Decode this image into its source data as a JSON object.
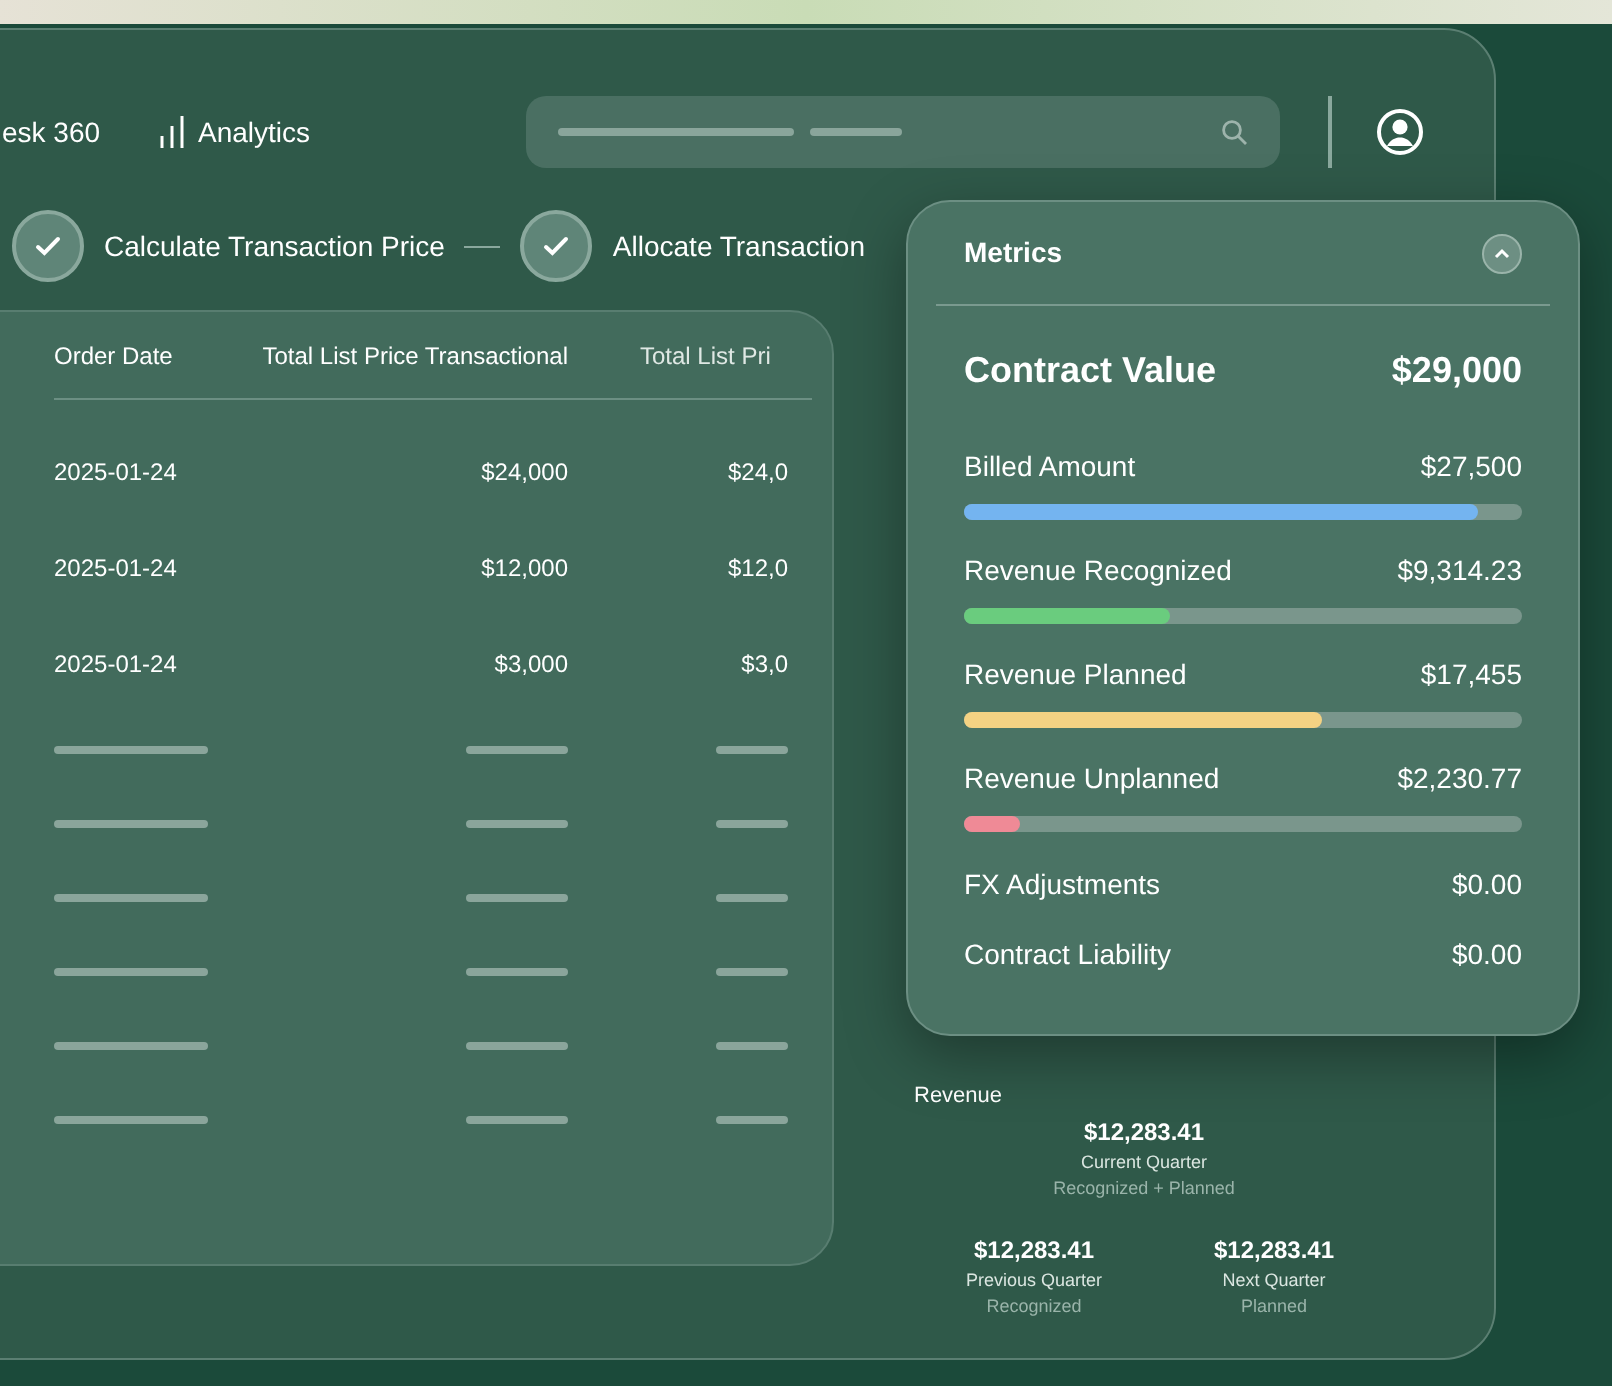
{
  "header": {
    "brand": "esk 360",
    "analytics": "Analytics"
  },
  "steps": [
    {
      "label": "Calculate Transaction Price",
      "checked": true
    },
    {
      "label": "Allocate Transaction",
      "checked": true
    }
  ],
  "table": {
    "columns": [
      "Order Date",
      "Total List Price Transactional",
      "Total List Pri"
    ],
    "rows": [
      {
        "kind": "data",
        "cells": [
          "2025-01-24",
          "$24,000",
          "$24,0"
        ]
      },
      {
        "kind": "data",
        "cells": [
          "2025-01-24",
          "$12,000",
          "$12,0"
        ]
      },
      {
        "kind": "data",
        "cells": [
          "2025-01-24",
          "$3,000",
          "$3,0"
        ]
      },
      {
        "kind": "placeholder"
      },
      {
        "kind": "placeholder"
      },
      {
        "kind": "placeholder"
      },
      {
        "kind": "placeholder"
      },
      {
        "kind": "placeholder"
      },
      {
        "kind": "placeholder"
      }
    ]
  },
  "metrics": {
    "title": "Metrics",
    "expanded": true,
    "items": [
      {
        "kind": "headline",
        "name": "Contract Value",
        "value": "$29,000"
      },
      {
        "kind": "bar",
        "name": "Billed Amount",
        "value": "$27,500",
        "level": 0.92,
        "color": "#74b4f0"
      },
      {
        "kind": "bar",
        "name": "Revenue Recognized",
        "value": "$9,314.23",
        "level": 0.37,
        "color": "#6acc7e"
      },
      {
        "kind": "bar",
        "name": "Revenue Planned",
        "value": "$17,455",
        "level": 0.64,
        "color": "#f4d283"
      },
      {
        "kind": "bar",
        "name": "Revenue Unplanned",
        "value": "$2,230.77",
        "level": 0.1,
        "color": "#ef8a96"
      },
      {
        "kind": "plain",
        "name": "FX Adjustments",
        "value": "$0.00"
      },
      {
        "kind": "plain",
        "name": "Contract Liability",
        "value": "$0.00"
      }
    ]
  },
  "revenue": {
    "title": "Revenue",
    "current": {
      "amount": "$12,283.41",
      "label": "Current Quarter",
      "note": "Recognized + Planned"
    },
    "others": [
      {
        "amount": "$12,283.41",
        "label": "Previous Quarter",
        "note": "Recognized"
      },
      {
        "amount": "$12,283.41",
        "label": "Next Quarter",
        "note": "Planned"
      }
    ]
  }
}
